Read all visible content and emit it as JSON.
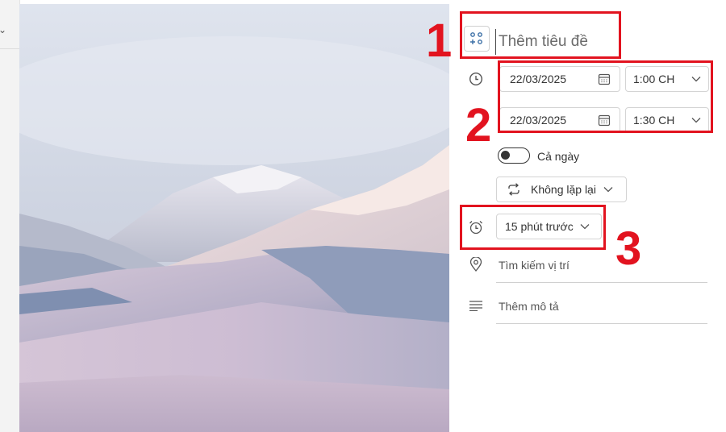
{
  "title": {
    "placeholder": "Thêm tiêu đề"
  },
  "start": {
    "date": "22/03/2025",
    "time": "1:00 CH"
  },
  "end": {
    "date": "22/03/2025",
    "time": "1:30 CH"
  },
  "all_day": {
    "label": "Cả ngày",
    "checked": false
  },
  "repeat": {
    "label": "Không lặp lại"
  },
  "reminder": {
    "label": "15 phút trước"
  },
  "location": {
    "placeholder": "Tìm kiếm vị trí"
  },
  "description": {
    "placeholder": "Thêm mô tả"
  },
  "annotations": {
    "step1": "1",
    "step2": "2",
    "step3": "3"
  },
  "colors": {
    "highlight": "#e2131f",
    "text": "#333333",
    "border": "#d4d4d4"
  },
  "icons": [
    "chevron-down-icon",
    "title-format-icon",
    "clock-icon",
    "calendar-icon",
    "repeat-icon",
    "alarm-icon",
    "location-pin-icon",
    "description-lines-icon"
  ]
}
